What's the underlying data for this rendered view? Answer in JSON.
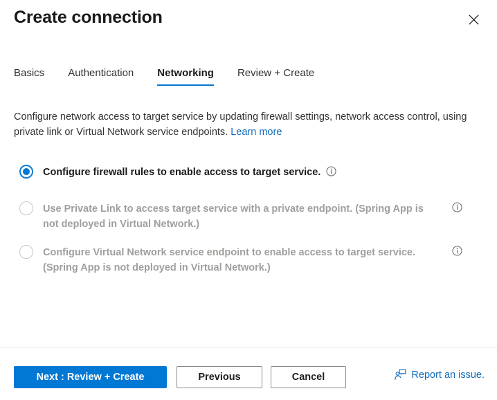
{
  "panel": {
    "title": "Create connection",
    "close_icon": "close-icon"
  },
  "tabs": [
    {
      "label": "Basics",
      "active": false
    },
    {
      "label": "Authentication",
      "active": false
    },
    {
      "label": "Networking",
      "active": true
    },
    {
      "label": "Review + Create",
      "active": false
    }
  ],
  "description": {
    "text": "Configure network access to target service by updating firewall settings, network access control, using private link or Virtual Network service endpoints.",
    "link_label": "Learn more"
  },
  "options": [
    {
      "label": "Configure firewall rules to enable access to target service.",
      "selected": true,
      "disabled": false,
      "info_icon": "info-icon",
      "info_position": "inline"
    },
    {
      "label": "Use Private Link to access target service with a private endpoint. (Spring App is not deployed in Virtual Network.)",
      "selected": false,
      "disabled": true,
      "info_icon": "info-icon",
      "info_position": "right"
    },
    {
      "label": "Configure Virtual Network service endpoint to enable access to target service. (Spring App is not deployed in Virtual Network.)",
      "selected": false,
      "disabled": true,
      "info_icon": "info-icon",
      "info_position": "right"
    }
  ],
  "footer": {
    "next_label": "Next : Review + Create",
    "previous_label": "Previous",
    "cancel_label": "Cancel",
    "report_label": "Report an issue.",
    "report_icon": "report-person-icon"
  },
  "colors": {
    "accent": "#0078d4",
    "link": "#0f6cbd",
    "text": "#323130",
    "disabled_text": "#a19f9d",
    "border": "#8a8886",
    "divider": "#edebe9"
  }
}
